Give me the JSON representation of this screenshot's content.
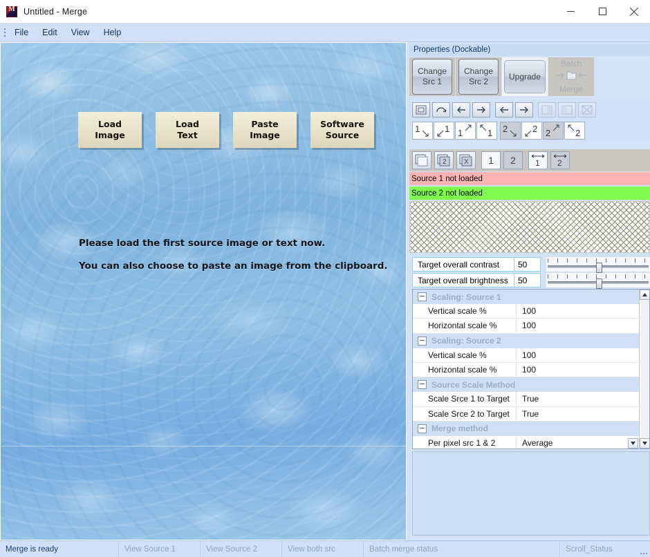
{
  "window": {
    "title": "Untitled - Merge",
    "icon": "app-icon",
    "minimize": "—",
    "maximize": "□",
    "close": "✕"
  },
  "menubar": {
    "items": [
      {
        "label": "File"
      },
      {
        "label": "Edit"
      },
      {
        "label": "View"
      },
      {
        "label": "Help"
      }
    ]
  },
  "canvas": {
    "buttons": [
      {
        "line1": "Load",
        "line2": "Image"
      },
      {
        "line1": "Load",
        "line2": "Text"
      },
      {
        "line1": "Paste",
        "line2": "Image"
      },
      {
        "line1": "Software",
        "line2": "Source"
      }
    ],
    "hint_line1": "Please load the first source image or text now.",
    "hint_line2": "You can also choose to paste an image from the clipboard."
  },
  "properties": {
    "title": "Properties (Dockable)",
    "big_buttons": [
      {
        "line1": "Change",
        "line2": "Src 1",
        "name": "change-src-1-button",
        "enabled": true
      },
      {
        "line1": "Change",
        "line2": "Src 2",
        "name": "change-src-2-button",
        "enabled": true
      },
      {
        "line1": "Upgrade",
        "line2": "",
        "name": "upgrade-button",
        "enabled": true
      },
      {
        "line1": "Batch",
        "line2": "Merge",
        "name": "batch-merge-button",
        "enabled": false
      }
    ],
    "toolbar_row2": [
      {
        "icon": "frame-icon",
        "name": "reset-view-tool"
      },
      {
        "icon": "rotate-cw-icon",
        "name": "rotate-tool"
      },
      {
        "icon": "arrow-left-icon",
        "name": "nudge-left-1-tool"
      },
      {
        "icon": "arrow-right-icon",
        "name": "nudge-right-1-tool"
      },
      {
        "icon": "arrow-left-icon",
        "name": "nudge-left-2-tool"
      },
      {
        "icon": "arrow-right-icon",
        "name": "nudge-right-2-tool"
      },
      {
        "icon": "split-left-icon",
        "name": "split-left-tool"
      },
      {
        "icon": "split-right-icon",
        "name": "split-right-tool"
      },
      {
        "icon": "cross-box-icon",
        "name": "clear-tool"
      }
    ],
    "toolbar_row3": [
      {
        "label": "1",
        "corner": "br",
        "name": "src1-bottom-right-tool"
      },
      {
        "label": "1",
        "corner": "bl",
        "name": "src1-bottom-left-tool"
      },
      {
        "label": "1",
        "corner": "tr",
        "name": "src1-top-right-tool"
      },
      {
        "label": "1",
        "corner": "tl",
        "name": "src1-top-left-tool"
      },
      {
        "label": "2",
        "corner": "br",
        "name": "src2-bottom-right-tool"
      },
      {
        "label": "2",
        "corner": "bl",
        "name": "src2-bottom-left-tool"
      },
      {
        "label": "2",
        "corner": "tr",
        "name": "src2-top-right-tool"
      },
      {
        "label": "2",
        "corner": "tl",
        "name": "src2-top-left-tool"
      }
    ],
    "toolbar_row4": [
      {
        "icon": "box-blank-icon",
        "label": "",
        "name": "view-target-tool"
      },
      {
        "icon": "box-2-icon",
        "label": "2",
        "name": "view-src2-tool"
      },
      {
        "icon": "box-x-icon",
        "label": "X",
        "name": "view-none-tool"
      },
      {
        "icon": "plain-1-icon",
        "label": "1",
        "name": "show-src1-tool"
      },
      {
        "icon": "plain-2-icon",
        "label": "2",
        "name": "show-src2-tool"
      },
      {
        "icon": "width-1-icon",
        "label": "1",
        "name": "fit-width-src1-tool"
      },
      {
        "icon": "width-2-icon",
        "label": "2",
        "name": "fit-width-src2-tool"
      }
    ],
    "status_strips": [
      {
        "text": "Source 1 not loaded",
        "color": "#ffb3b3"
      },
      {
        "text": "Source 2 not loaded",
        "color": "#7dfa4b"
      }
    ],
    "sliders": [
      {
        "label": "Target overall contrast",
        "value": "50",
        "percent": 50
      },
      {
        "label": "Target overall brightness",
        "value": "50",
        "percent": 50
      }
    ],
    "grid_rows": [
      {
        "type": "category",
        "label": "Scaling: Source 1"
      },
      {
        "type": "kv",
        "key": "Vertical scale %",
        "value": "100"
      },
      {
        "type": "kv",
        "key": "Horizontal scale %",
        "value": "100"
      },
      {
        "type": "category",
        "label": "Scaling: Source 2"
      },
      {
        "type": "kv",
        "key": "Vertical scale %",
        "value": "100"
      },
      {
        "type": "kv",
        "key": "Horizontal scale %",
        "value": "100"
      },
      {
        "type": "category",
        "label": "Source Scale Method"
      },
      {
        "type": "kv",
        "key": "Scale Srce 1 to Target",
        "value": "True"
      },
      {
        "type": "kv",
        "key": "Scale Srce 2 to Target",
        "value": "True"
      },
      {
        "type": "category",
        "label": "Merge method"
      },
      {
        "type": "kv",
        "key": "Per pixel src 1 & 2",
        "value": "Average",
        "combo": true
      }
    ]
  },
  "statusbar": {
    "cells": [
      {
        "text": "Merge is ready",
        "active": true
      },
      {
        "text": "View Source 1",
        "active": false
      },
      {
        "text": "View Source 2",
        "active": false
      },
      {
        "text": "View both src",
        "active": false
      },
      {
        "text": "Batch merge status",
        "active": false
      },
      {
        "text": "Scroll_Status",
        "active": false
      }
    ]
  }
}
